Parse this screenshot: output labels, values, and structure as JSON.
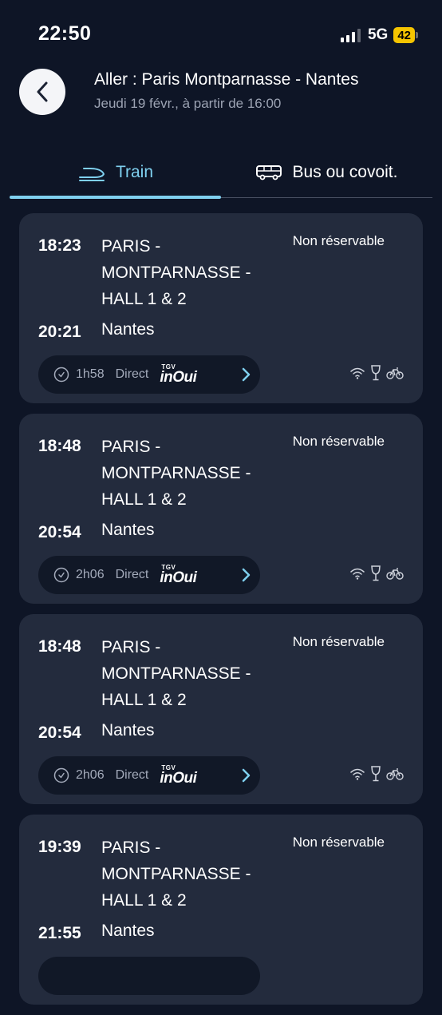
{
  "status_bar": {
    "time": "22:50",
    "network": "5G",
    "battery": "42"
  },
  "header": {
    "title": "Aller : Paris Montparnasse - Nantes",
    "subtitle": "Jeudi 19 févr., à partir de 16:00"
  },
  "tabs": [
    {
      "label": "Train",
      "selected": true
    },
    {
      "label": "Bus ou covoit.",
      "selected": false
    }
  ],
  "colors": {
    "accent": "#7fd0ef",
    "background": "#0e1526",
    "card": "#232b3d",
    "pill": "#111827"
  },
  "journeys": [
    {
      "departure_time": "18:23",
      "departure_station": "PARIS - MONTPARNASSE - HALL 1 & 2",
      "arrival_time": "20:21",
      "arrival_station": "Nantes",
      "availability": "Non réservable",
      "duration": "1h58",
      "type": "Direct",
      "brand_small": "TGV",
      "brand": "inOui",
      "amenities": [
        "wifi-icon",
        "bar-icon",
        "bike-icon"
      ]
    },
    {
      "departure_time": "18:48",
      "departure_station": "PARIS - MONTPARNASSE - HALL 1 & 2",
      "arrival_time": "20:54",
      "arrival_station": "Nantes",
      "availability": "Non réservable",
      "duration": "2h06",
      "type": "Direct",
      "brand_small": "TGV",
      "brand": "inOui",
      "amenities": [
        "wifi-icon",
        "bar-icon",
        "bike-icon"
      ]
    },
    {
      "departure_time": "18:48",
      "departure_station": "PARIS - MONTPARNASSE - HALL 1 & 2",
      "arrival_time": "20:54",
      "arrival_station": "Nantes",
      "availability": "Non réservable",
      "duration": "2h06",
      "type": "Direct",
      "brand_small": "TGV",
      "brand": "inOui",
      "amenities": [
        "wifi-icon",
        "bar-icon",
        "bike-icon"
      ]
    },
    {
      "departure_time": "19:39",
      "departure_station": "PARIS - MONTPARNASSE - HALL 1 & 2",
      "arrival_time": "21:55",
      "arrival_station": "Nantes",
      "availability": "Non réservable",
      "duration": "",
      "type": "",
      "brand_small": "",
      "brand": "",
      "amenities": []
    }
  ]
}
